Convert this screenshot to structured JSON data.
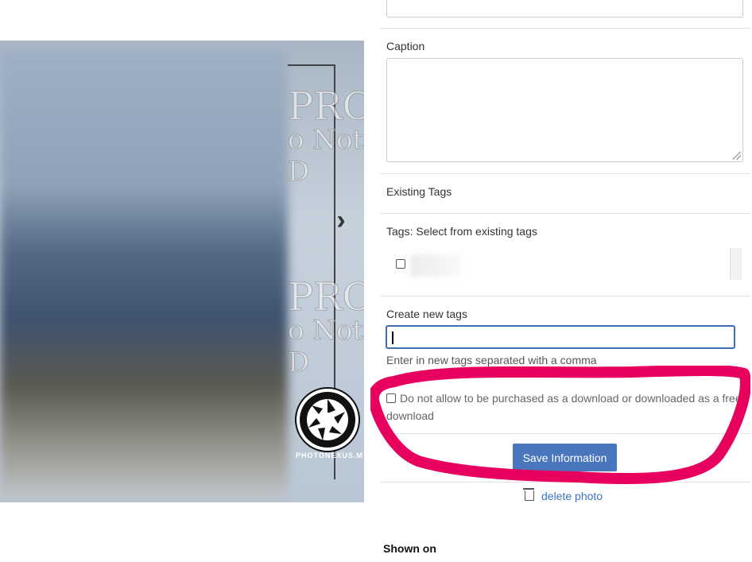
{
  "photo": {
    "watermark_line1": "PRO",
    "watermark_line2": "o Not D",
    "next_arrow": "›",
    "brand_text": "PHOTONEXUS.MY"
  },
  "form": {
    "caption_label": "Caption",
    "caption_value": "",
    "existing_tags_label": "Existing Tags",
    "select_tags_label": "Tags: Select from existing tags",
    "tag_items": [
      {
        "label": "S",
        "checked": false
      }
    ],
    "create_tags_label": "Create new tags",
    "new_tags_value": "",
    "new_tags_help": "Enter in new tags separated with a comma",
    "no_download_option": {
      "label": "Do not allow to be purchased as a download or downloaded as a free download",
      "checked": false
    },
    "save_button": "Save Information",
    "delete_link": "delete photo",
    "shown_on_heading": "Shown on"
  },
  "colors": {
    "accent": "#4a76bd",
    "link": "#3b74c7",
    "highlight_stroke": "#e8005f",
    "focus_border": "#3e6fb6"
  },
  "icons": {
    "next": "chevron-right-icon",
    "trash": "trash-icon",
    "logo": "camera-shutter-logo"
  }
}
